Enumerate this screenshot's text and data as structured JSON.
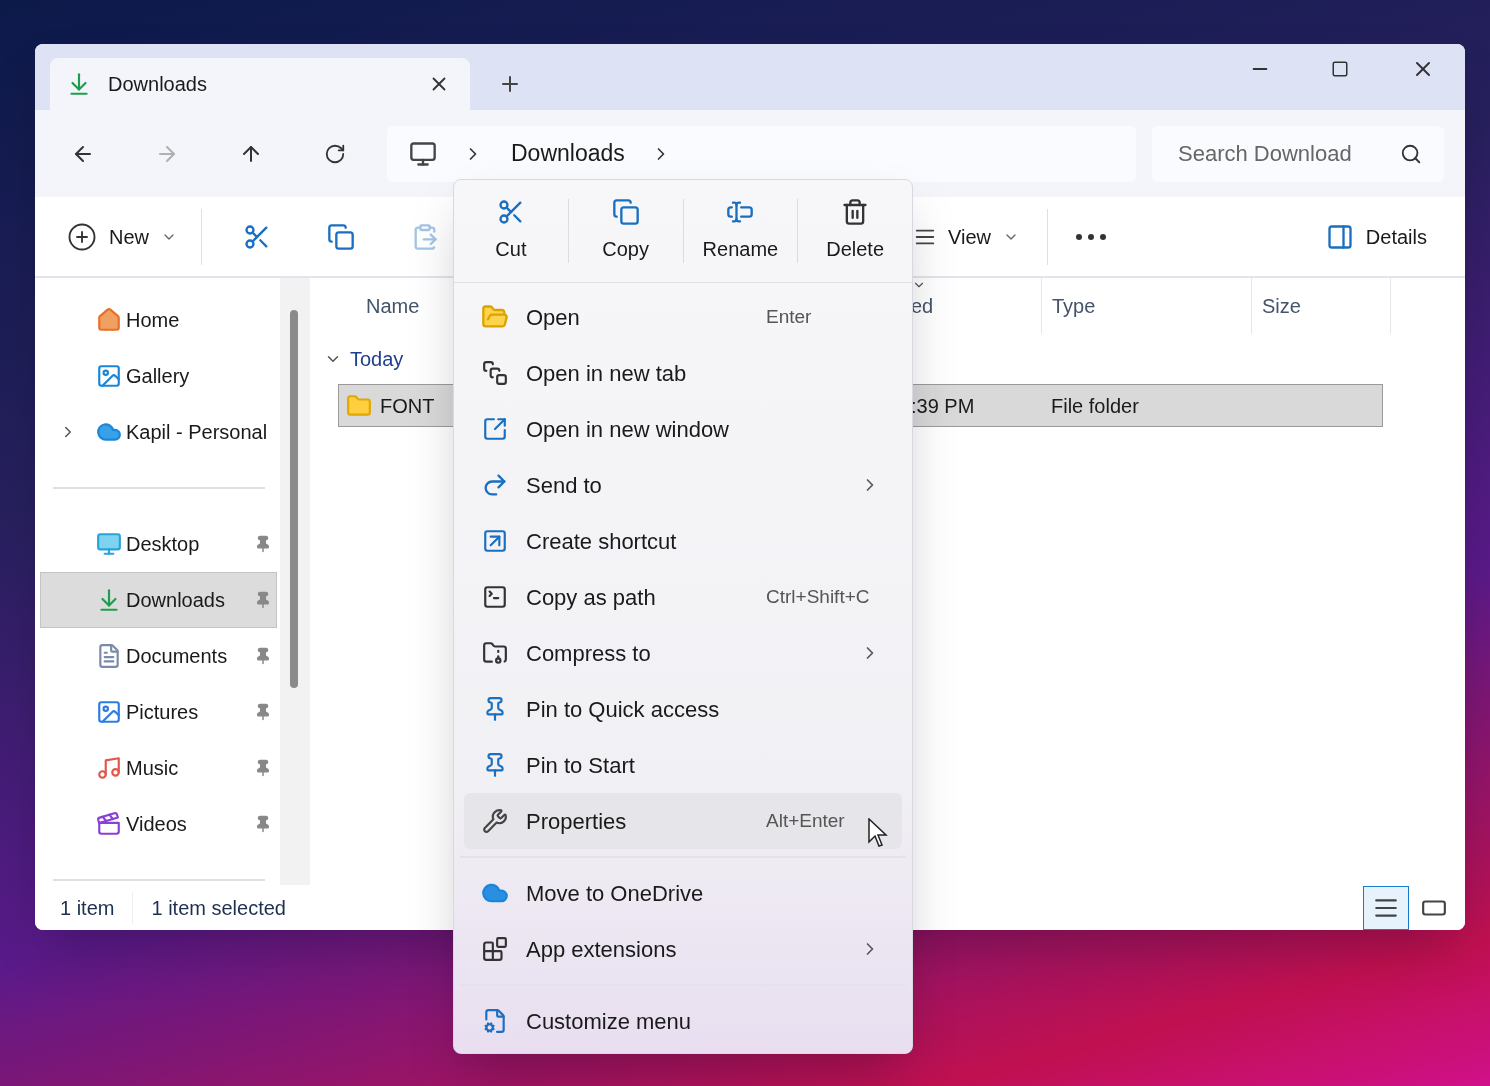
{
  "tab": {
    "title": "Downloads",
    "selected": true
  },
  "nav_buttons": [
    {
      "kind": "back",
      "disabled": false
    },
    {
      "kind": "forward",
      "disabled": true
    },
    {
      "kind": "up",
      "disabled": false
    },
    {
      "kind": "refresh",
      "disabled": false
    }
  ],
  "address": {
    "segments": [
      "Downloads"
    ]
  },
  "search": {
    "placeholder": "Search Download"
  },
  "toolbar": {
    "items": [
      {
        "kind": "new",
        "label": "New",
        "disabled": false
      },
      {
        "kind": "cut",
        "disabled": false
      },
      {
        "kind": "copy",
        "disabled": false
      },
      {
        "kind": "paste",
        "disabled": true
      },
      {
        "kind": "view",
        "label": "View",
        "disabled": false
      },
      {
        "kind": "more",
        "disabled": false
      },
      {
        "kind": "details",
        "label": "Details",
        "disabled": false
      }
    ]
  },
  "sidebar": {
    "groups": [
      [
        {
          "label": "Home",
          "selected": false,
          "pinned": false,
          "expandable": false
        },
        {
          "label": "Gallery",
          "selected": false,
          "pinned": false,
          "expandable": false
        },
        {
          "label": "Kapil - Personal",
          "selected": false,
          "pinned": false,
          "expandable": true
        }
      ],
      [
        {
          "label": "Desktop",
          "selected": false,
          "pinned": true,
          "expandable": false
        },
        {
          "label": "Downloads",
          "selected": true,
          "pinned": true,
          "expandable": false
        },
        {
          "label": "Documents",
          "selected": false,
          "pinned": true,
          "expandable": false
        },
        {
          "label": "Pictures",
          "selected": false,
          "pinned": true,
          "expandable": false
        },
        {
          "label": "Music",
          "selected": false,
          "pinned": true,
          "expandable": false
        },
        {
          "label": "Videos",
          "selected": false,
          "pinned": true,
          "expandable": false
        }
      ]
    ]
  },
  "columns": [
    {
      "label": "Name",
      "sorted": false
    },
    {
      "label": "ed",
      "sorted": true
    },
    {
      "label": "Type",
      "sorted": false
    },
    {
      "label": "Size",
      "sorted": false
    }
  ],
  "groups": [
    {
      "label": "Today",
      "expanded": true,
      "rows": [
        {
          "name": "FONT",
          "date": ":39 PM",
          "type": "File folder",
          "selected": true
        }
      ]
    }
  ],
  "status_bar": {
    "count": "1 item",
    "selection": "1 item selected",
    "views": [
      {
        "kind": "details",
        "selected": true
      },
      {
        "kind": "tiles",
        "selected": false
      }
    ]
  },
  "context_menu": {
    "actions": [
      {
        "label": "Cut"
      },
      {
        "label": "Copy"
      },
      {
        "label": "Rename"
      },
      {
        "label": "Delete"
      }
    ],
    "items": [
      {
        "kind": "item",
        "label": "Open",
        "shortcut": "Enter",
        "submenu": false,
        "highlighted": false
      },
      {
        "kind": "item",
        "label": "Open in new tab",
        "submenu": false,
        "highlighted": false
      },
      {
        "kind": "item",
        "label": "Open in new window",
        "submenu": false,
        "highlighted": false
      },
      {
        "kind": "item",
        "label": "Send to",
        "submenu": true,
        "highlighted": false
      },
      {
        "kind": "item",
        "label": "Create shortcut",
        "submenu": false,
        "highlighted": false
      },
      {
        "kind": "item",
        "label": "Copy as path",
        "shortcut": "Ctrl+Shift+C",
        "submenu": false,
        "highlighted": false
      },
      {
        "kind": "item",
        "label": "Compress to",
        "submenu": true,
        "highlighted": false
      },
      {
        "kind": "item",
        "label": "Pin to Quick access",
        "submenu": false,
        "highlighted": false
      },
      {
        "kind": "item",
        "label": "Pin to Start",
        "submenu": false,
        "highlighted": false
      },
      {
        "kind": "item",
        "label": "Properties",
        "shortcut": "Alt+Enter",
        "submenu": false,
        "highlighted": true
      },
      {
        "kind": "separator"
      },
      {
        "kind": "item",
        "label": "Move to OneDrive",
        "submenu": false,
        "highlighted": false
      },
      {
        "kind": "item",
        "label": "App extensions",
        "submenu": true,
        "highlighted": false
      },
      {
        "kind": "separator"
      },
      {
        "kind": "item",
        "label": "Customize menu",
        "submenu": false,
        "highlighted": false
      }
    ]
  }
}
